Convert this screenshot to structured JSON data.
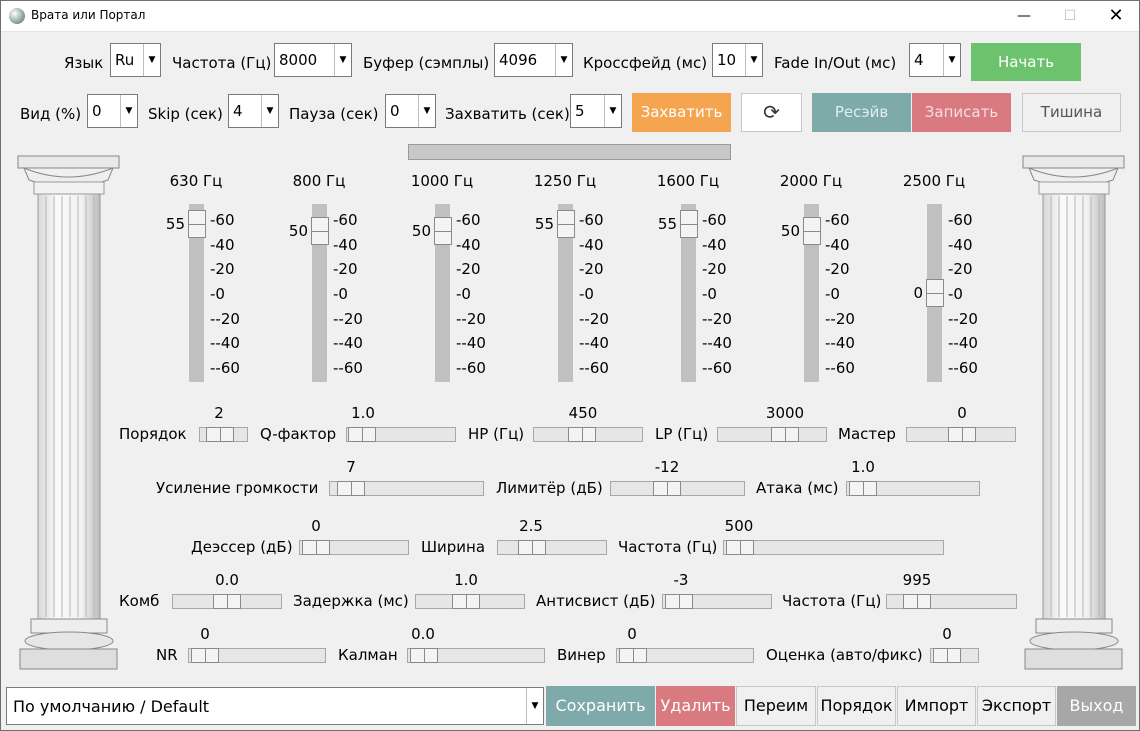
{
  "window": {
    "title": "Врата или Портал",
    "minimize": "—",
    "maximize": "☐",
    "close": "✕"
  },
  "row1": {
    "lang_label": "Язык",
    "lang_value": "Ru",
    "freq_label": "Частота (Гц)",
    "freq_value": "8000",
    "buffer_label": "Буфер (сэмплы)",
    "buffer_value": "4096",
    "crossfade_label": "Кроссфейд (мс)",
    "crossfade_value": "10",
    "fade_label": "Fade In/Out (мс)",
    "fade_value": "4",
    "start_button": "Начать"
  },
  "row2": {
    "view_label": "Вид (%)",
    "view_value": "0",
    "skip_label": "Skip (сек)",
    "skip_value": "4",
    "pause_label": "Пауза (сек)",
    "pause_value": "0",
    "capture_label": "Захватить (сек)",
    "capture_value": "5",
    "capture_button": "Захватить",
    "refresh_icon": "⟳",
    "receive_button": "Ресэйв",
    "record_button": "Записать",
    "silence_button": "Тишина"
  },
  "progress": {
    "value": 0
  },
  "eq": {
    "ticks": [
      "-60",
      "-40",
      "-20",
      "-0",
      "--20",
      "--40",
      "--60"
    ],
    "bands": [
      {
        "freq": "630 Гц",
        "value": "55",
        "level": 55
      },
      {
        "freq": "800 Гц",
        "value": "50",
        "level": 50
      },
      {
        "freq": "1000 Гц",
        "value": "50",
        "level": 50
      },
      {
        "freq": "1250 Гц",
        "value": "55",
        "level": 55
      },
      {
        "freq": "1600 Гц",
        "value": "55",
        "level": 55
      },
      {
        "freq": "2000 Гц",
        "value": "50",
        "level": 50
      },
      {
        "freq": "2500 Гц",
        "value": "0",
        "level": 0
      }
    ]
  },
  "controls": {
    "order": {
      "label": "Порядок",
      "value": "2"
    },
    "q": {
      "label": "Q-фактор",
      "value": "1.0"
    },
    "hp": {
      "label": "HP (Гц)",
      "value": "450"
    },
    "lp": {
      "label": "LP (Гц)",
      "value": "3000"
    },
    "master": {
      "label": "Мастер",
      "value": "0"
    },
    "gain": {
      "label": "Усиление громкости",
      "value": "7"
    },
    "limiter": {
      "label": "Лимитёр (дБ)",
      "value": "-12"
    },
    "attack": {
      "label": "Атака (мс)",
      "value": "1.0"
    },
    "deesser": {
      "label": "Деэссер (дБ)",
      "value": "0"
    },
    "width": {
      "label": "Ширина",
      "value": "2.5"
    },
    "deess_freq": {
      "label": "Частота (Гц)",
      "value": "500"
    },
    "comb": {
      "label": "Комб",
      "value": "0.0"
    },
    "delay": {
      "label": "Задержка (мс)",
      "value": "1.0"
    },
    "antiwhistle": {
      "label": "Антисвист (дБ)",
      "value": "-3"
    },
    "aw_freq": {
      "label": "Частота (Гц)",
      "value": "995"
    },
    "nr": {
      "label": "NR",
      "value": "0"
    },
    "kalman": {
      "label": "Калман",
      "value": "0.0"
    },
    "wiener": {
      "label": "Винер",
      "value": "0"
    },
    "estimate": {
      "label": "Оценка (авто/фикс)",
      "value": "0"
    }
  },
  "bottom": {
    "preset_value": "По умолчанию / Default",
    "save": "Сохранить",
    "delete": "Удалить",
    "rename": "Переим",
    "order": "Порядок",
    "import": "Импорт",
    "export": "Экспорт",
    "exit": "Выход"
  },
  "colors": {
    "start": "#6dc36d",
    "capture": "#f5a54f",
    "receive": "#7faaaa",
    "record": "#d97a80",
    "exit": "#a7a7a7"
  }
}
